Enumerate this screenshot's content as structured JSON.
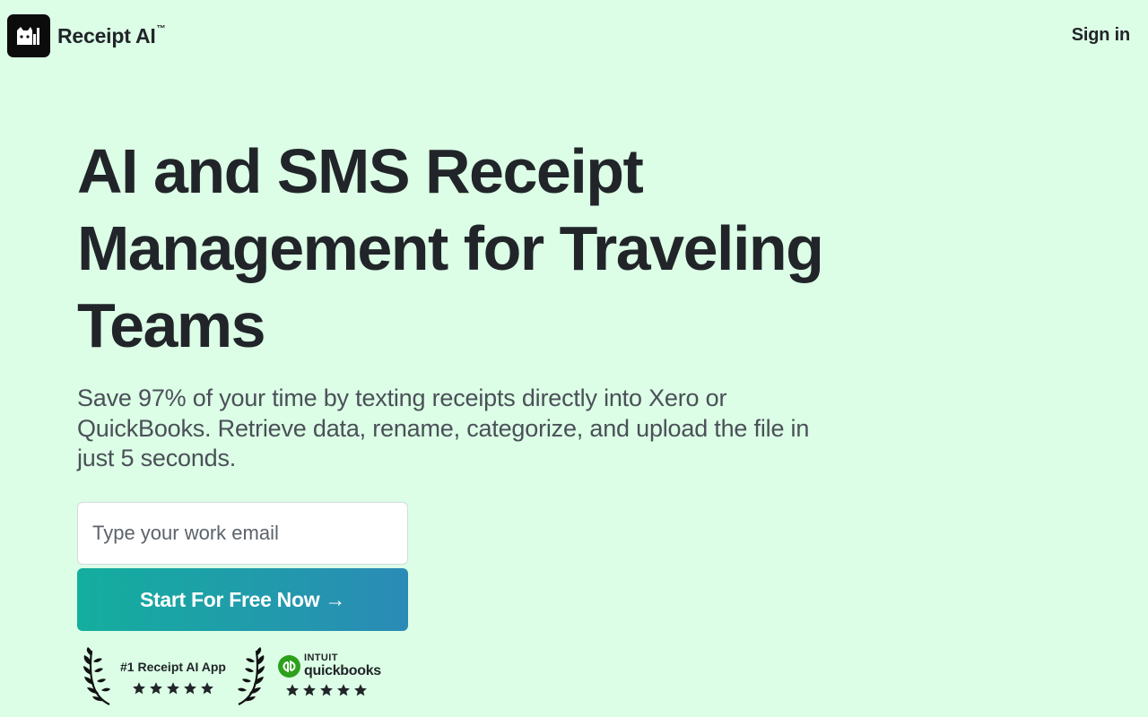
{
  "header": {
    "brand_name": "Receipt AI",
    "brand_mark": "™",
    "signin_label": "Sign in"
  },
  "hero": {
    "title": "AI and SMS Receipt Management for Traveling Teams",
    "subtitle": "Save 97% of your time by texting receipts directly into Xero or QuickBooks. Retrieve data, rename, categorize, and upload the file in just 5 seconds."
  },
  "signup": {
    "email_placeholder": "Type your work email",
    "cta_label": "Start For Free Now",
    "cta_arrow": "→"
  },
  "badges": {
    "award_text": "#1 Receipt AI App",
    "award_rating": 5,
    "quickbooks_brand": "INTUIT",
    "quickbooks_name": "quickbooks",
    "quickbooks_rating": 5
  },
  "colors": {
    "background": "#dcfee6",
    "text": "#212529",
    "cta_gradient_start": "#14ae9e",
    "cta_gradient_end": "#2b8bb6",
    "quickbooks_green": "#2ca01c"
  },
  "icons": {
    "logo": "cat-receipt-logo-icon",
    "laurel": "laurel-wreath-icon",
    "star": "star-icon",
    "quickbooks": "quickbooks-logo-icon"
  }
}
